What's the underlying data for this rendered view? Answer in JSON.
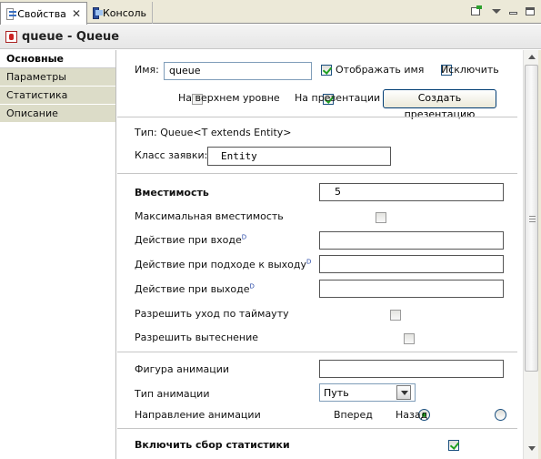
{
  "tabs": [
    {
      "label": "Свойства",
      "active": true
    },
    {
      "label": "Консоль",
      "active": false
    }
  ],
  "header": {
    "title": "queue - Queue"
  },
  "sidebar": {
    "items": [
      {
        "label": "Основные",
        "active": true
      },
      {
        "label": "Параметры",
        "active": false
      },
      {
        "label": "Статистика",
        "active": false
      },
      {
        "label": "Описание",
        "active": false
      }
    ]
  },
  "form": {
    "name_label": "Имя:",
    "name_value": "queue",
    "show_name_label": "Отображать имя",
    "show_name_checked": true,
    "exclude_label": "Исключить",
    "exclude_checked": false,
    "top_level_label": "На верхнем уровне",
    "top_level_checked": false,
    "on_presentation_label": "На презентации",
    "on_presentation_checked": true,
    "create_presentation_button": "Создать презентацию",
    "type_text": "Тип: Queue<T extends Entity>",
    "agent_class_label": "Класс заявки:",
    "agent_class_value": "Entity",
    "capacity_label": "Вместимость",
    "capacity_value": "5",
    "max_capacity_label": "Максимальная вместимость",
    "on_enter_label": "Действие при входе",
    "on_at_exit_label": "Действие при подходе к выходу",
    "on_exit_label": "Действие при выходе",
    "dynamic_marker": "D",
    "enable_timeout_label": "Разрешить уход по таймауту",
    "enable_preemption_label": "Разрешить вытеснение",
    "anim_shape_label": "Фигура анимации",
    "anim_type_label": "Тип анимации",
    "anim_type_value": "Путь",
    "anim_direction_label": "Направление анимации",
    "direction_forward_label": "Вперед",
    "direction_backward_label": "Назад",
    "direction_selected": "Вперед",
    "stats_label": "Включить сбор статистики",
    "stats_checked": true
  },
  "toolbar_icons": [
    "pin-icon",
    "view-menu-icon",
    "minimize-icon",
    "maximize-icon"
  ]
}
